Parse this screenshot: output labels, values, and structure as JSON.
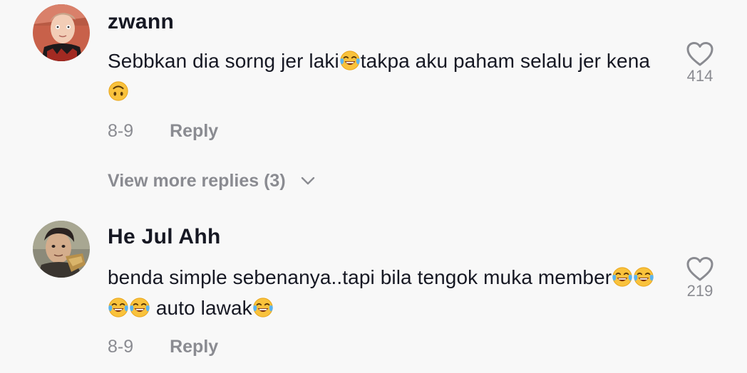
{
  "comments": [
    {
      "username": "zwann",
      "text_parts": [
        "Sebbkan dia sorng jer laki",
        "takpa aku paham selalu jer kena"
      ],
      "emojis": [
        "face-with-tears-of-joy",
        "upside-down-face"
      ],
      "date": "8-9",
      "reply_label": "Reply",
      "likes": "414",
      "view_more": "View more replies (3)"
    },
    {
      "username": "He Jul Ahh",
      "text_parts": [
        "benda simple sebenanya..tapi bila tengok muka member",
        " auto lawak"
      ],
      "emojis": [
        "face-with-tears-of-joy",
        "face-with-tears-of-joy",
        "face-with-tears-of-joy",
        "face-with-tears-of-joy",
        "face-with-tears-of-joy"
      ],
      "date": "8-9",
      "reply_label": "Reply",
      "likes": "219"
    }
  ],
  "colors": {
    "background": "#f8f8f8",
    "primary_text": "#161823",
    "secondary_text": "#8a8b91",
    "emoji_yellow": "#f9c23c",
    "emoji_tears": "#5ab4f0"
  }
}
